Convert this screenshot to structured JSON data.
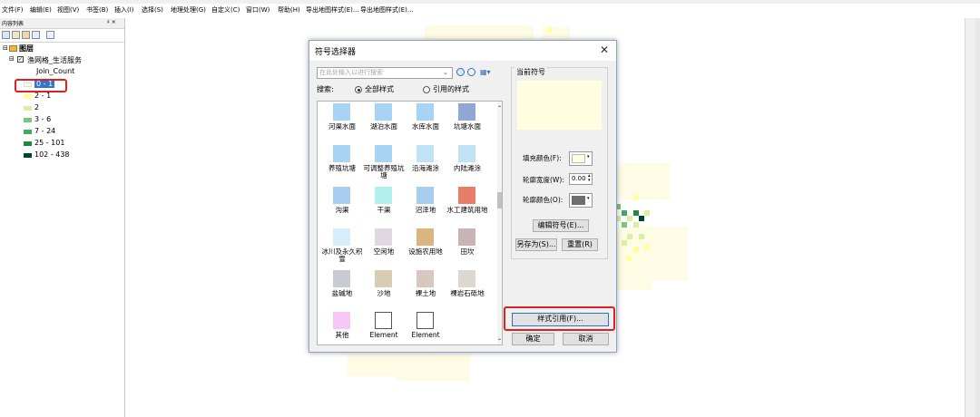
{
  "menu": [
    "文件(F)",
    "编辑(E)",
    "视图(V)",
    "书签(B)",
    "插入(I)",
    "选择(S)",
    "地理处理(G)",
    "自定义(C)",
    "窗口(W)",
    "帮助(H)",
    "导出地图样式(E)...",
    "导出地图样式(E)..."
  ],
  "toc": {
    "title": "内容列表",
    "pin": "♯ ×",
    "layers_label": "图层",
    "layer_name": "渔网格_生活服务",
    "field_name": "Join_Count",
    "legend": [
      {
        "label": "0 - 1",
        "color": "#fffee0",
        "selected": true
      },
      {
        "label": "2 - 1",
        "color": "#ffff99"
      },
      {
        "label": "2",
        "color": "#d9f0a3"
      },
      {
        "label": "3 - 6",
        "color": "#78c679"
      },
      {
        "label": "7 - 24",
        "color": "#41ab5d"
      },
      {
        "label": "25 - 101",
        "color": "#238443"
      },
      {
        "label": "102 - 438",
        "color": "#004529"
      }
    ]
  },
  "dialog": {
    "title": "符号选择器",
    "search_placeholder": "在此处输入以进行搜索",
    "search_label": "搜索:",
    "radio_all": "全部样式",
    "radio_ref": "引用的样式",
    "current_symbol_label": "当前符号",
    "fill_color_label": "填充颜色(F):",
    "outline_width_label": "轮廓宽度(W):",
    "outline_width_value": "0.00",
    "outline_color_label": "轮廓颜色(O):",
    "edit_symbol": "编辑符号(E)...",
    "save_as": "另存为(S)...",
    "reset": "重置(R)",
    "style_ref": "样式引用(F)...",
    "ok": "确定",
    "cancel": "取消",
    "fill_color": "#fffee0",
    "outline_color": "#6e6e6e",
    "preview_color": "#fffee0",
    "symbols": [
      {
        "label": "河渠水面",
        "color": "#a7d3f5"
      },
      {
        "label": "湖泊水面",
        "color": "#a7d3f5"
      },
      {
        "label": "水库水面",
        "color": "#a7d3f5"
      },
      {
        "label": "坑塘水面",
        "color": "#8ea7d6"
      },
      {
        "label": "养殖坑塘",
        "color": "#a7d3f5"
      },
      {
        "label": "可调整养殖坑塘",
        "color": "#a7d3f5"
      },
      {
        "label": "沿海滩涂",
        "color": "#bfe3f5"
      },
      {
        "label": "内陆滩涂",
        "color": "#bfe3f5"
      },
      {
        "label": "沟渠",
        "color": "#a7cdf0"
      },
      {
        "label": "干渠",
        "color": "#b2f0ee"
      },
      {
        "label": "沼泽地",
        "color": "#a7cdf0"
      },
      {
        "label": "水工建筑用地",
        "color": "#e87d6a"
      },
      {
        "label": "冰川及永久积雪",
        "color": "#d6eefa"
      },
      {
        "label": "空闲地",
        "color": "#e0d8e0"
      },
      {
        "label": "设施农用地",
        "color": "#dcb482"
      },
      {
        "label": "田坎",
        "color": "#c8b4b4"
      },
      {
        "label": "盐碱地",
        "color": "#c8cbd2"
      },
      {
        "label": "沙地",
        "color": "#d8ccb4"
      },
      {
        "label": "裸土地",
        "color": "#d8c8c0"
      },
      {
        "label": "裸岩石砾地",
        "color": "#dcd8d0"
      },
      {
        "label": "其他",
        "color": "#f5c8f5"
      },
      {
        "label": "Element",
        "color": "#ffffff"
      },
      {
        "label": "Element",
        "color": "#ffffff"
      }
    ]
  }
}
